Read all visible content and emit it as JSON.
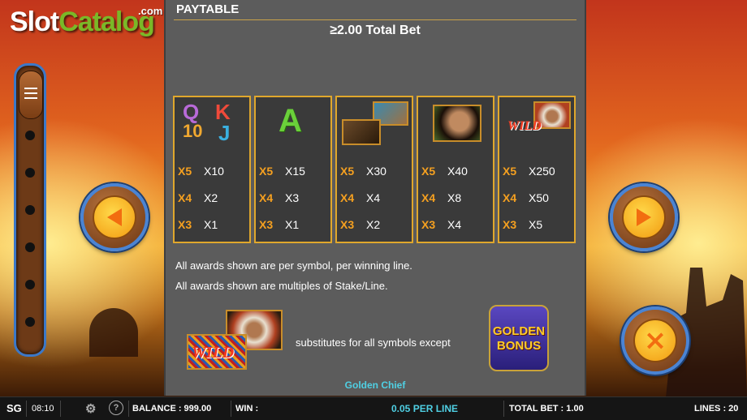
{
  "logo": {
    "slot": "Slot",
    "catalog": "Catalog",
    "com": ".com"
  },
  "paytable": {
    "title": "PAYTABLE",
    "bet_header": "≥2.00 Total Bet",
    "cards": [
      {
        "symbol": "royals QKJ10",
        "letters": [
          "Q",
          "K",
          "10",
          "J"
        ],
        "rows": [
          {
            "mult": "X5",
            "pay": "X10"
          },
          {
            "mult": "X4",
            "pay": "X2"
          },
          {
            "mult": "X3",
            "pay": "X1"
          }
        ]
      },
      {
        "symbol": "ace",
        "letters": [
          "A"
        ],
        "rows": [
          {
            "mult": "X5",
            "pay": "X15"
          },
          {
            "mult": "X4",
            "pay": "X3"
          },
          {
            "mult": "X3",
            "pay": "X1"
          }
        ]
      },
      {
        "symbol": "bear and tomahawk",
        "rows": [
          {
            "mult": "X5",
            "pay": "X30"
          },
          {
            "mult": "X4",
            "pay": "X4"
          },
          {
            "mult": "X3",
            "pay": "X2"
          }
        ]
      },
      {
        "symbol": "native woman",
        "rows": [
          {
            "mult": "X5",
            "pay": "X40"
          },
          {
            "mult": "X4",
            "pay": "X8"
          },
          {
            "mult": "X3",
            "pay": "X4"
          }
        ]
      },
      {
        "symbol": "chief wild",
        "rows": [
          {
            "mult": "X5",
            "pay": "X250"
          },
          {
            "mult": "X4",
            "pay": "X50"
          },
          {
            "mult": "X3",
            "pay": "X5"
          }
        ]
      }
    ],
    "note1": "All awards shown are per symbol, per winning line.",
    "note2": "All awards shown are multiples of Stake/Line.",
    "wild_label": "WILD",
    "substitutes_text": "substitutes for all symbols except",
    "golden_bonus": [
      "GOLDEN",
      "BONUS"
    ],
    "game_name": "Golden Chief"
  },
  "bottom_bar": {
    "brand": "SG",
    "time": "08:10",
    "balance": "BALANCE : 999.00",
    "win": "WIN :",
    "per_line": "0.05 PER LINE",
    "total_bet": "TOTAL BET : 1.00",
    "lines": "LINES : 20"
  },
  "icons": {
    "settings": "gear-icon",
    "help": "question-icon",
    "prev": "arrow-left-icon",
    "next": "arrow-right-icon",
    "close": "close-icon"
  },
  "colors": {
    "accent_orange": "#f5a020",
    "button_ring": "#4a84d4",
    "per_line": "#4fd0e4"
  }
}
